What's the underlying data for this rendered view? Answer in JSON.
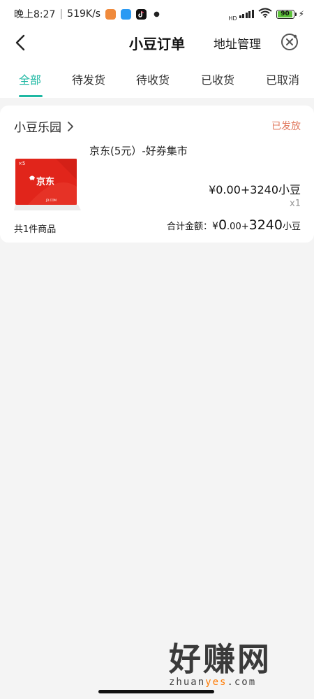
{
  "status_bar": {
    "time": "晚上8:27",
    "separator": "|",
    "network_speed": "519K/s",
    "battery_level": "90",
    "app_icons": [
      "app-icon-orange",
      "app-icon-blue",
      "tiktok-icon"
    ]
  },
  "header": {
    "title": "小豆订单",
    "address_label": "地址管理"
  },
  "tabs": [
    {
      "label": "全部",
      "active": true
    },
    {
      "label": "待发货",
      "active": false
    },
    {
      "label": "待收货",
      "active": false
    },
    {
      "label": "已收货",
      "active": false
    },
    {
      "label": "已取消",
      "active": false
    }
  ],
  "order": {
    "shop_name": "小豆乐园",
    "status": "已发放",
    "product": {
      "name": "京东(5元）-好券集市",
      "thumb_text": "京东",
      "thumb_badge": "×5",
      "price": "¥0.00+3240小豆",
      "quantity": "x1"
    },
    "item_count": "共1件商品",
    "total": {
      "label": "合计金额：",
      "currency": "¥",
      "amount_int": "0",
      "amount_dec": ".00+",
      "beans": "3240",
      "unit": "小豆"
    }
  },
  "watermark": {
    "text_cn": "好赚网",
    "url_pre": "zhuan",
    "url_hl": "yes",
    "url_post": ".com"
  },
  "colors": {
    "accent": "#1fb8a3",
    "status": "#e07a5f",
    "jd_red": "#e1251b"
  }
}
